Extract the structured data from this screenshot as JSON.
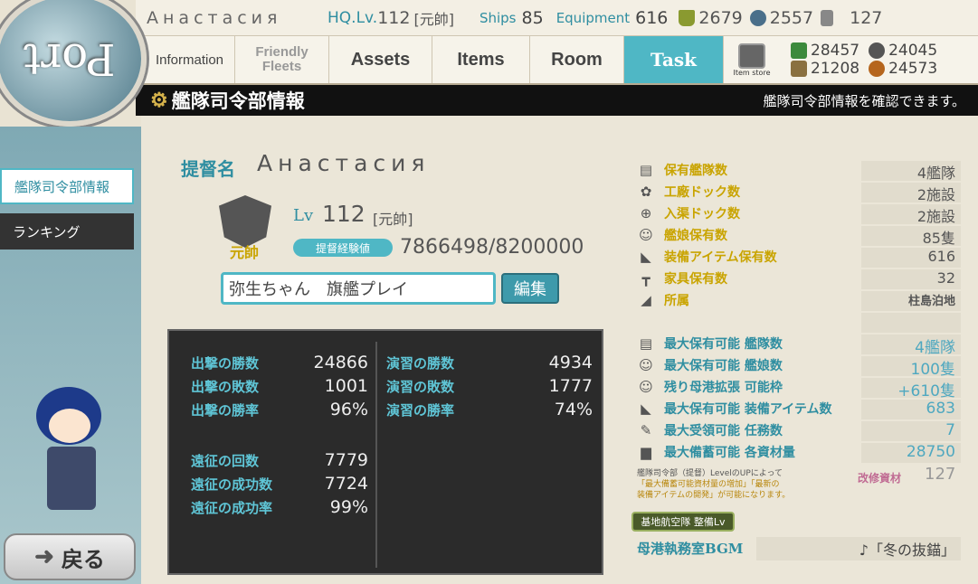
{
  "header": {
    "admiral_name": "Анастасия",
    "hq_label": "HQ.Lv.",
    "hq_level": "112",
    "hq_rank": "[元帥]",
    "ships_label": "Ships",
    "ships_value": "85",
    "equipment_label": "Equipment",
    "equipment_value": "616",
    "bucket": "2679",
    "devmat": "2557",
    "screw": "127"
  },
  "nav": {
    "information": "Information",
    "friendly_fleets": "Friendly Fleets",
    "assets": "Assets",
    "items": "Items",
    "room": "Room",
    "task": "Task",
    "item_store": "Item store"
  },
  "resources": {
    "fuel": "28457",
    "ammo": "24045",
    "steel": "21208",
    "bauxite": "24573"
  },
  "title": {
    "main": "艦隊司令部情報",
    "sub": "艦隊司令部情報を確認できます。"
  },
  "port_label": "Port",
  "sidebar": {
    "item1": "艦隊司令部情報",
    "item2": "ランキング",
    "back": "戻る"
  },
  "profile": {
    "admiral_label": "提督名",
    "name": "Анастасия",
    "emblem_text": "元帥",
    "lv_label": "Lv",
    "level": "112",
    "rank": "[元帥]",
    "exp_label": "提督経験値",
    "exp_value": "7866498/8200000",
    "comment": "弥生ちゃん　旗艦プレイ",
    "edit": "編集"
  },
  "record": {
    "sortie_wins_label": "出撃の勝数",
    "sortie_wins": "24866",
    "sortie_losses_label": "出撃の敗数",
    "sortie_losses": "1001",
    "sortie_rate_label": "出撃の勝率",
    "sortie_rate": "96%",
    "exped_count_label": "遠征の回数",
    "exped_count": "7779",
    "exped_success_label": "遠征の成功数",
    "exped_success": "7724",
    "exped_rate_label": "遠征の成功率",
    "exped_rate": "99%",
    "pvp_wins_label": "演習の勝数",
    "pvp_wins": "4934",
    "pvp_losses_label": "演習の敗数",
    "pvp_losses": "1777",
    "pvp_rate_label": "演習の勝率",
    "pvp_rate": "74%"
  },
  "stats": [
    {
      "label": "保有艦隊数",
      "value": "4艦隊",
      "icon": "fleet"
    },
    {
      "label": "工廠ドック数",
      "value": "2施設",
      "icon": "gear"
    },
    {
      "label": "入渠ドック数",
      "value": "2施設",
      "icon": "repair"
    },
    {
      "label": "艦娘保有数",
      "value": "85隻",
      "icon": "girl"
    },
    {
      "label": "装備アイテム保有数",
      "value": "616",
      "icon": "equip"
    },
    {
      "label": "家具保有数",
      "value": "32",
      "icon": "furniture"
    },
    {
      "label": "所属",
      "value": "柱島泊地",
      "icon": "base"
    }
  ],
  "max_stats": [
    {
      "label": "最大保有可能 艦隊数",
      "value": "4艦隊",
      "icon": "fleet"
    },
    {
      "label": "最大保有可能 艦娘数",
      "value": "100隻",
      "icon": "girl"
    },
    {
      "label": "残り母港拡張 可能枠",
      "value": "+610隻",
      "icon": "girl"
    },
    {
      "label": "最大保有可能 装備アイテム数",
      "value": "683",
      "icon": "equip"
    },
    {
      "label": "最大受領可能 任務数",
      "value": "7",
      "icon": "quill"
    },
    {
      "label": "最大備蓄可能 各資材量",
      "value": "28750",
      "icon": "storage"
    }
  ],
  "note": {
    "line1": "艦隊司令部（提督）LevelのUPによって",
    "line2": "「最大備蓄可能資材量の増加」「最新の",
    "line3": "装備アイテムの開発」が可能になります。"
  },
  "kaishu": {
    "label": "改修資材",
    "value": "127"
  },
  "air_button": "基地航空隊 整備Lv",
  "bgm": {
    "label": "母港執務室BGM",
    "value": "♪「冬の抜錨」"
  }
}
